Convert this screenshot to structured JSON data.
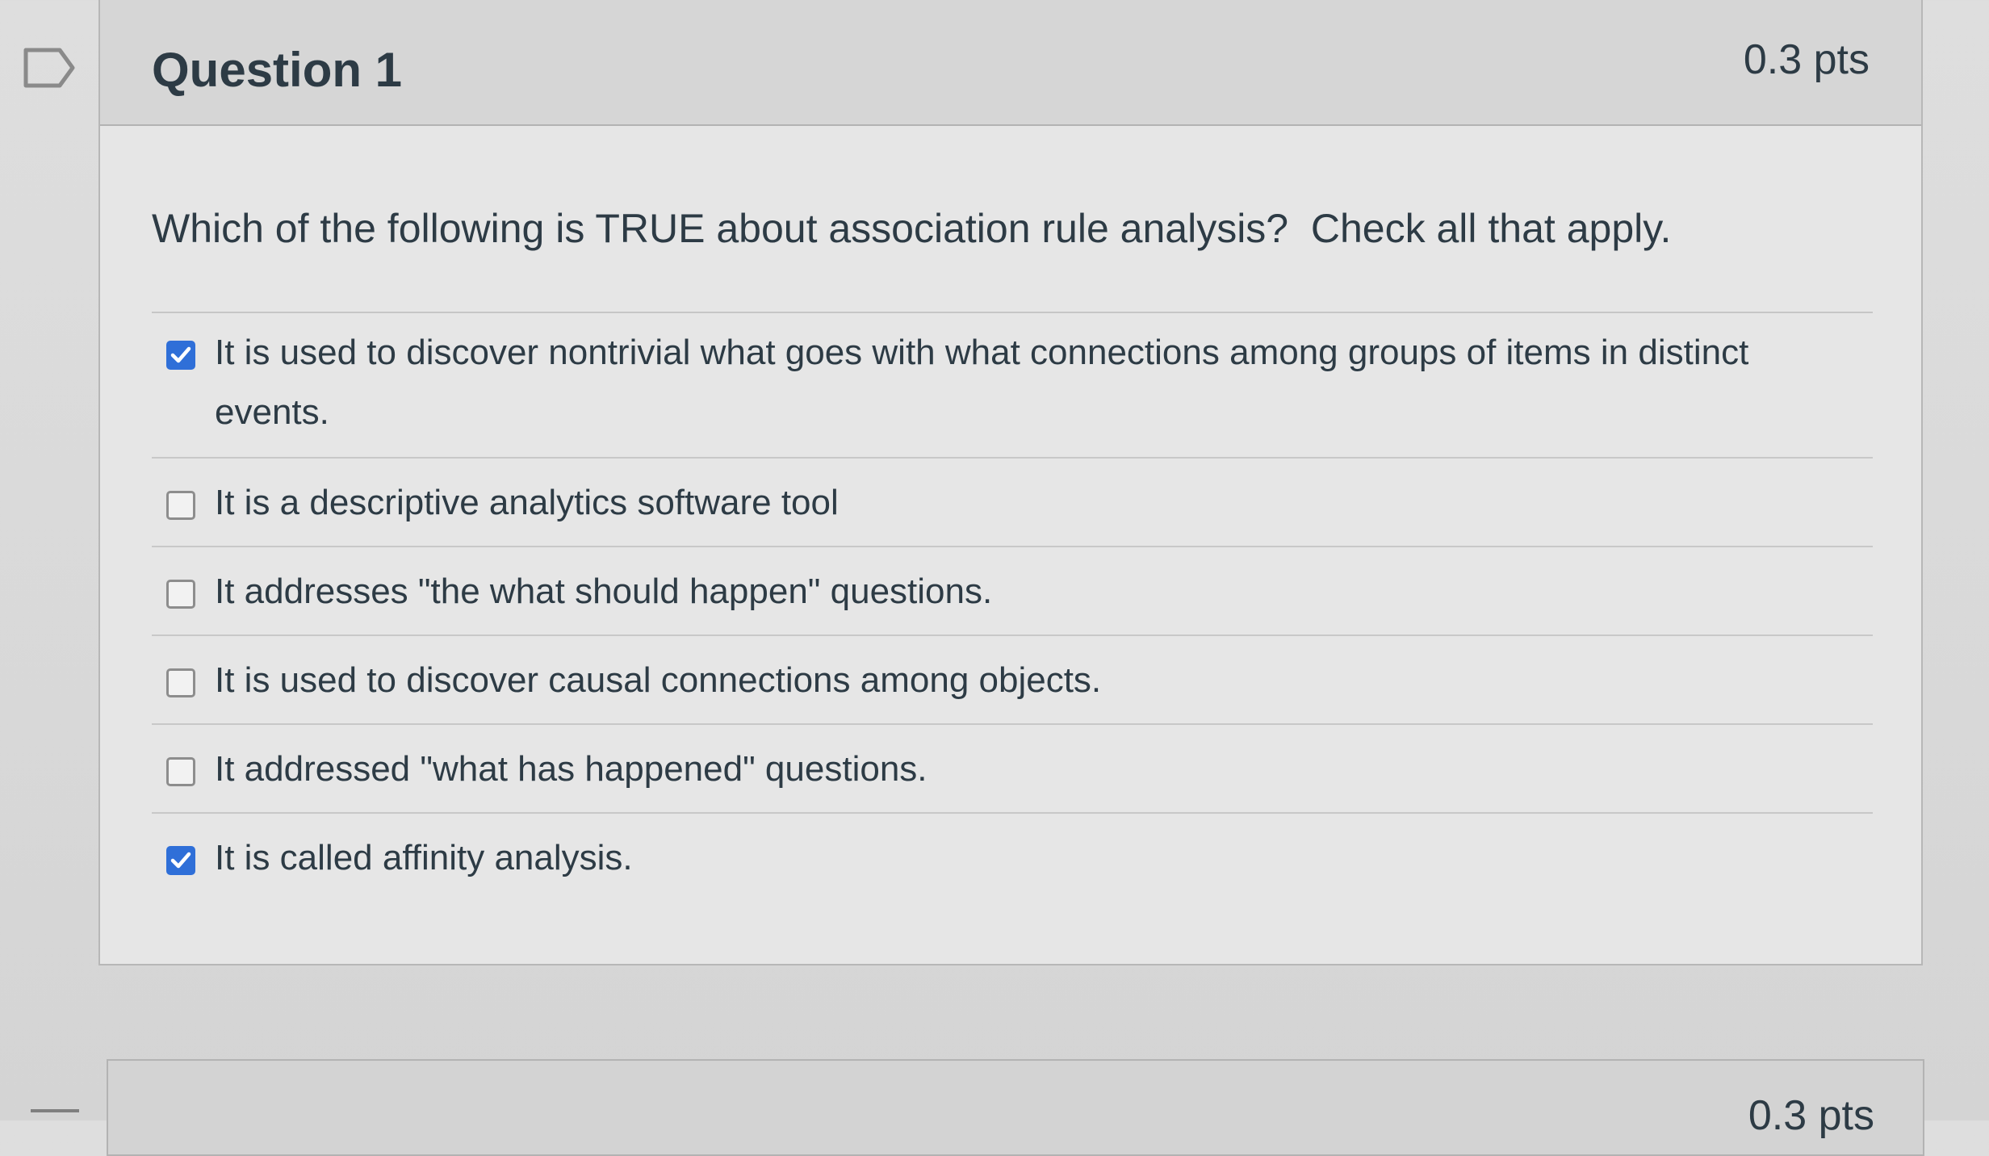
{
  "question": {
    "title": "Question 1",
    "points": "0.3 pts",
    "text": "Which of the following is TRUE about association rule analysis?  Check all that apply.",
    "answers": [
      {
        "label": "It is used to discover nontrivial what goes with what connections among groups of items in distinct events.",
        "checked": true
      },
      {
        "label": "It is a descriptive analytics software tool",
        "checked": false
      },
      {
        "label": "It addresses \"the what should happen\" questions.",
        "checked": false
      },
      {
        "label": "It is used to discover causal connections among objects.",
        "checked": false
      },
      {
        "label": "It addressed \"what has happened\" questions.",
        "checked": false
      },
      {
        "label": "It is called affinity analysis.",
        "checked": true
      }
    ]
  },
  "next_question": {
    "points": "0.3 pts"
  },
  "icons": {
    "flag": "bookmark-flag-icon",
    "check": "checkmark-icon"
  },
  "colors": {
    "checkbox_checked": "#2f6fd8",
    "text": "#2d3b45",
    "header_bg": "#d6d6d6"
  }
}
